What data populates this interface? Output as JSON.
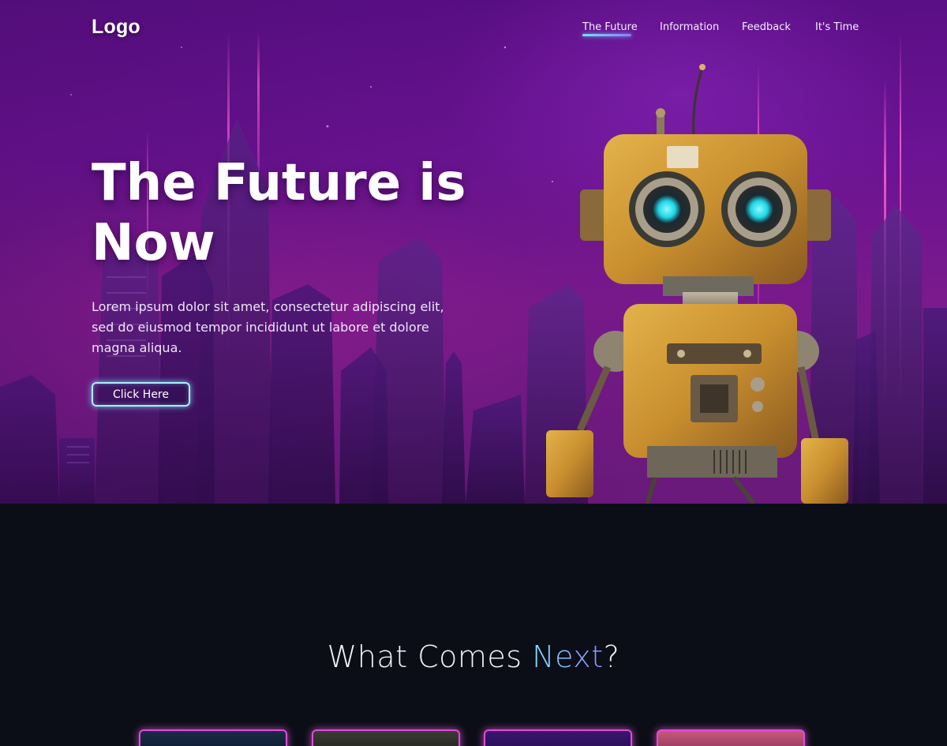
{
  "nav": {
    "logo": "Logo",
    "items": [
      {
        "label": "The Future",
        "active": true
      },
      {
        "label": "Information",
        "active": false
      },
      {
        "label": "Feedback",
        "active": false
      },
      {
        "label": "It's Time",
        "active": false
      }
    ]
  },
  "hero": {
    "title_line1": "The Future is",
    "title_line2": "Now",
    "body": "Lorem ipsum dolor sit amet, consectetur adipiscing elit, sed do eiusmod tempor incididunt ut labore et dolore magna aliqua.",
    "cta_label": "Click Here"
  },
  "section": {
    "title_prefix": "What Comes ",
    "title_accent": "Next",
    "title_suffix": "?"
  },
  "colors": {
    "hero_purple": "#6b1394",
    "page_dark": "#0b0e16",
    "accent_cyan": "#7de3ff",
    "card_glow": "#e04bd9"
  }
}
